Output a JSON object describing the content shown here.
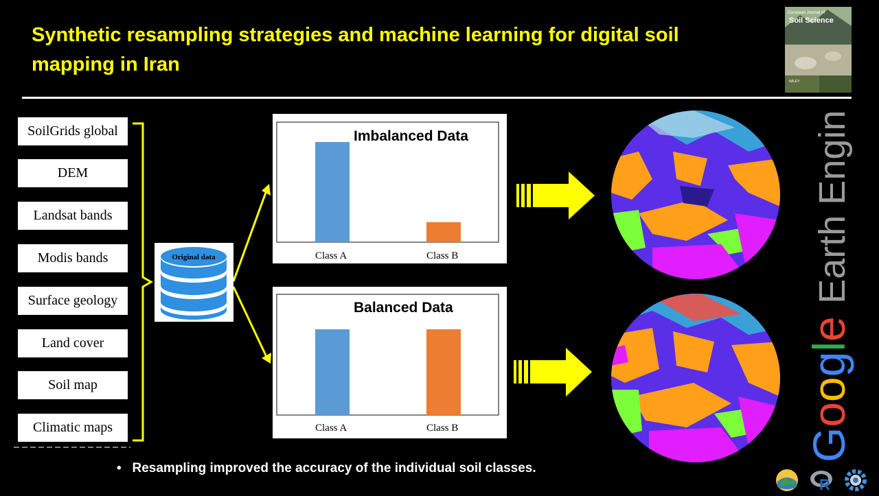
{
  "title": "Synthetic resampling strategies and machine learning for digital soil mapping in Iran",
  "journal_cover": {
    "text_top": "European Journal of",
    "text_name": "Soil Science",
    "publisher": "WILEY"
  },
  "sources": [
    "SoilGrids global",
    "DEM",
    "Landsat bands",
    "Modis bands",
    "Surface geology",
    "Land cover",
    "Soil map",
    "Climatic maps"
  ],
  "database_label": "Original data",
  "charts": [
    {
      "title": "Imbalanced Data",
      "categories": [
        "Class A",
        "Class B"
      ],
      "values": [
        1.0,
        0.2
      ],
      "colors": [
        "#5b9bd5",
        "#ed7d31"
      ]
    },
    {
      "title": "Balanced Data",
      "categories": [
        "Class A",
        "Class B"
      ],
      "values": [
        1.0,
        1.0
      ],
      "colors": [
        "#5b9bd5",
        "#ed7d31"
      ]
    }
  ],
  "platform_label": "Google Earth Engine",
  "footnote": "Resampling improved the accuracy of the individual soil classes.",
  "logos": [
    "qgis-logo",
    "r-logo",
    "gear-logo"
  ],
  "colors": {
    "title": "#ffff00",
    "arrow": "#ffff00",
    "map_purple": "#6a2cff",
    "map_orange": "#ff9f1a",
    "map_green": "#7cff3a",
    "map_magenta": "#e01eff"
  }
}
